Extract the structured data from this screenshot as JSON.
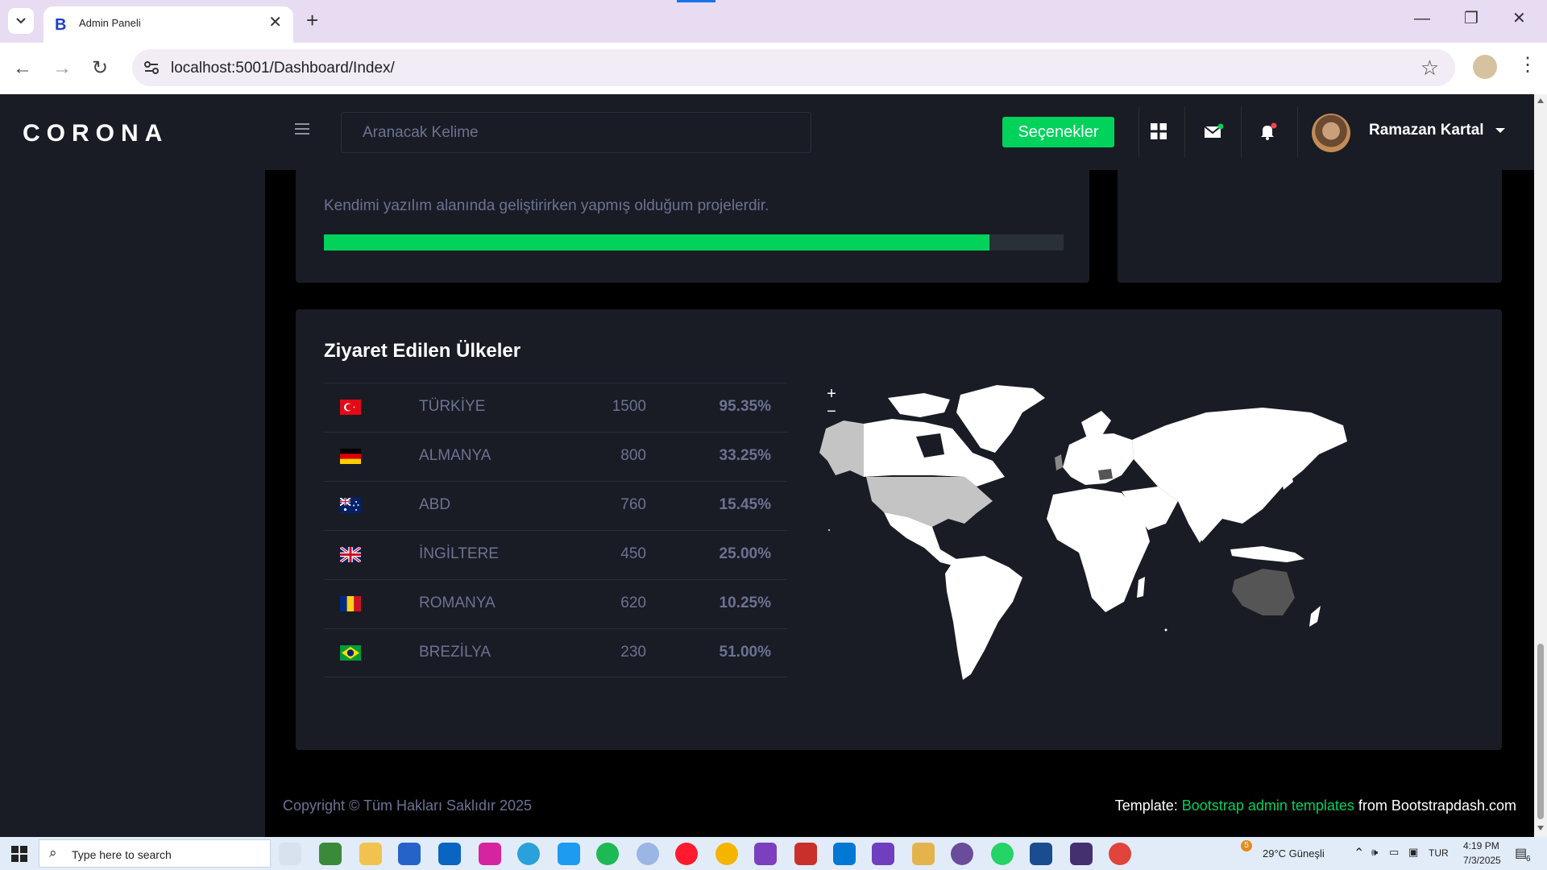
{
  "browser": {
    "tab_title": "Admin Paneli",
    "tab_favicon": "B",
    "url": "localhost:5001/Dashboard/Index/"
  },
  "app": {
    "brand": "CORONA",
    "search_placeholder": "Aranacak Kelime",
    "options_button": "Seçenekler",
    "user_name": "Ramazan Kartal"
  },
  "projects_card": {
    "description": "Kendimi yazılım alanında geliştirirken yapmış olduğum projelerdir.",
    "progress_fraction": 0.9
  },
  "countries_card": {
    "title": "Ziyaret Edilen Ülkeler",
    "rows": [
      {
        "flag": "turkey",
        "name": "TÜRKİYE",
        "count": "1500",
        "percent": "95.35%"
      },
      {
        "flag": "germany",
        "name": "ALMANYA",
        "count": "800",
        "percent": "33.25%"
      },
      {
        "flag": "australia",
        "name": "ABD",
        "count": "760",
        "percent": "15.45%"
      },
      {
        "flag": "uk",
        "name": "İNGİLTERE",
        "count": "450",
        "percent": "25.00%"
      },
      {
        "flag": "romania",
        "name": "ROMANYA",
        "count": "620",
        "percent": "10.25%"
      },
      {
        "flag": "brazil",
        "name": "BREZİLYA",
        "count": "230",
        "percent": "51.00%"
      }
    ],
    "map_zoom_in": "+",
    "map_zoom_out": "−"
  },
  "footer": {
    "copyright": "Copyright © Tüm Hakları Saklıdır 2025",
    "template_prefix": "Template: ",
    "template_link": "Bootstrap admin templates",
    "template_suffix": " from Bootstrapdash.com"
  },
  "taskbar": {
    "search_placeholder": "Type here to search",
    "weather": "29°C  Güneşli",
    "weather_badge": "5",
    "language": "TUR",
    "time": "4:19 PM",
    "date": "7/3/2025",
    "notification_count": "6"
  },
  "colors": {
    "accent_green": "#00d25b",
    "card_bg": "#191c24",
    "muted_text": "#6c7293"
  }
}
